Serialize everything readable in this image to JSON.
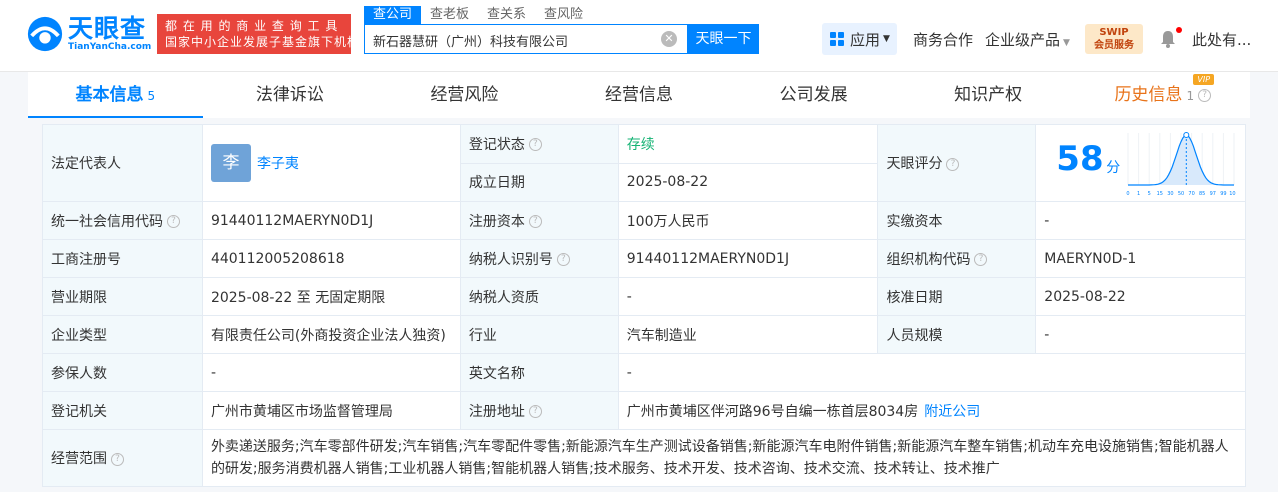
{
  "brand": {
    "name_cn": "天眼查",
    "name_en": "TianYanCha.com",
    "slogan_line1": "都 在 用 的 商 业 查 询 工 具",
    "slogan_line2": "国家中小企业发展子基金旗下机构"
  },
  "search": {
    "tabs": [
      "查公司",
      "查老板",
      "查关系",
      "查风险"
    ],
    "query": "新石器慧研（广州）科技有限公司",
    "button": "天眼一下"
  },
  "nav": {
    "apps": "应用",
    "business": "商务合作",
    "enterprise": "企业级产品",
    "vip_line1": "SWIP",
    "vip_line2": "会员服务",
    "user": "此处有..."
  },
  "subnav": [
    {
      "label": "基本信息",
      "count": "5"
    },
    {
      "label": "法律诉讼"
    },
    {
      "label": "经营风险"
    },
    {
      "label": "经营信息"
    },
    {
      "label": "公司发展"
    },
    {
      "label": "知识产权"
    },
    {
      "label": "历史信息",
      "count": "1",
      "tag": "VIP"
    }
  ],
  "info": {
    "legal_rep_label": "法定代表人",
    "legal_rep_avatar": "李",
    "legal_rep_name": "李子夷",
    "status_label": "登记状态",
    "status": "存续",
    "found_label": "成立日期",
    "found": "2025-08-22",
    "score_label": "天眼评分",
    "score": "58",
    "score_unit": "分",
    "credit_label": "统一社会信用代码",
    "credit": "91440112MAERYN0D1J",
    "capital_label": "注册资本",
    "capital": "100万人民币",
    "paid_label": "实缴资本",
    "paid": "-",
    "reg_no_label": "工商注册号",
    "reg_no": "440112005208618",
    "tax_id_label": "纳税人识别号",
    "tax_id": "91440112MAERYN0D1J",
    "org_code_label": "组织机构代码",
    "org_code": "MAERYN0D-1",
    "term_label": "营业期限",
    "term": "2025-08-22 至 无固定期限",
    "tax_qual_label": "纳税人资质",
    "tax_qual": "-",
    "approve_label": "核准日期",
    "approve": "2025-08-22",
    "type_label": "企业类型",
    "type": "有限责任公司(外商投资企业法人独资)",
    "industry_label": "行业",
    "industry": "汽车制造业",
    "staff_label": "人员规模",
    "staff": "-",
    "insured_label": "参保人数",
    "insured": "-",
    "en_name_label": "英文名称",
    "en_name": "-",
    "authority_label": "登记机关",
    "authority": "广州市黄埔区市场监督管理局",
    "address_label": "注册地址",
    "address": "广州市黄埔区伴河路96号自编一栋首层8034房",
    "nearby": "附近公司",
    "scope_label": "经营范围",
    "scope": "外卖递送服务;汽车零部件研发;汽车销售;汽车零配件零售;新能源汽车生产测试设备销售;新能源汽车电附件销售;新能源汽车整车销售;机动车充电设施销售;智能机器人的研发;服务消费机器人销售;工业机器人销售;智能机器人销售;技术服务、技术开发、技术咨询、技术交流、技术转让、技术推广"
  },
  "score_chart": {
    "ticks": [
      "0",
      "1",
      "5",
      "15",
      "30",
      "50",
      "70",
      "85",
      "97",
      "99",
      "100"
    ],
    "marker": "58"
  },
  "colors": {
    "accent": "#0084ff",
    "status_green": "#15b374",
    "slogan_red": "#e8453c",
    "history_orange": "#e8731a"
  }
}
